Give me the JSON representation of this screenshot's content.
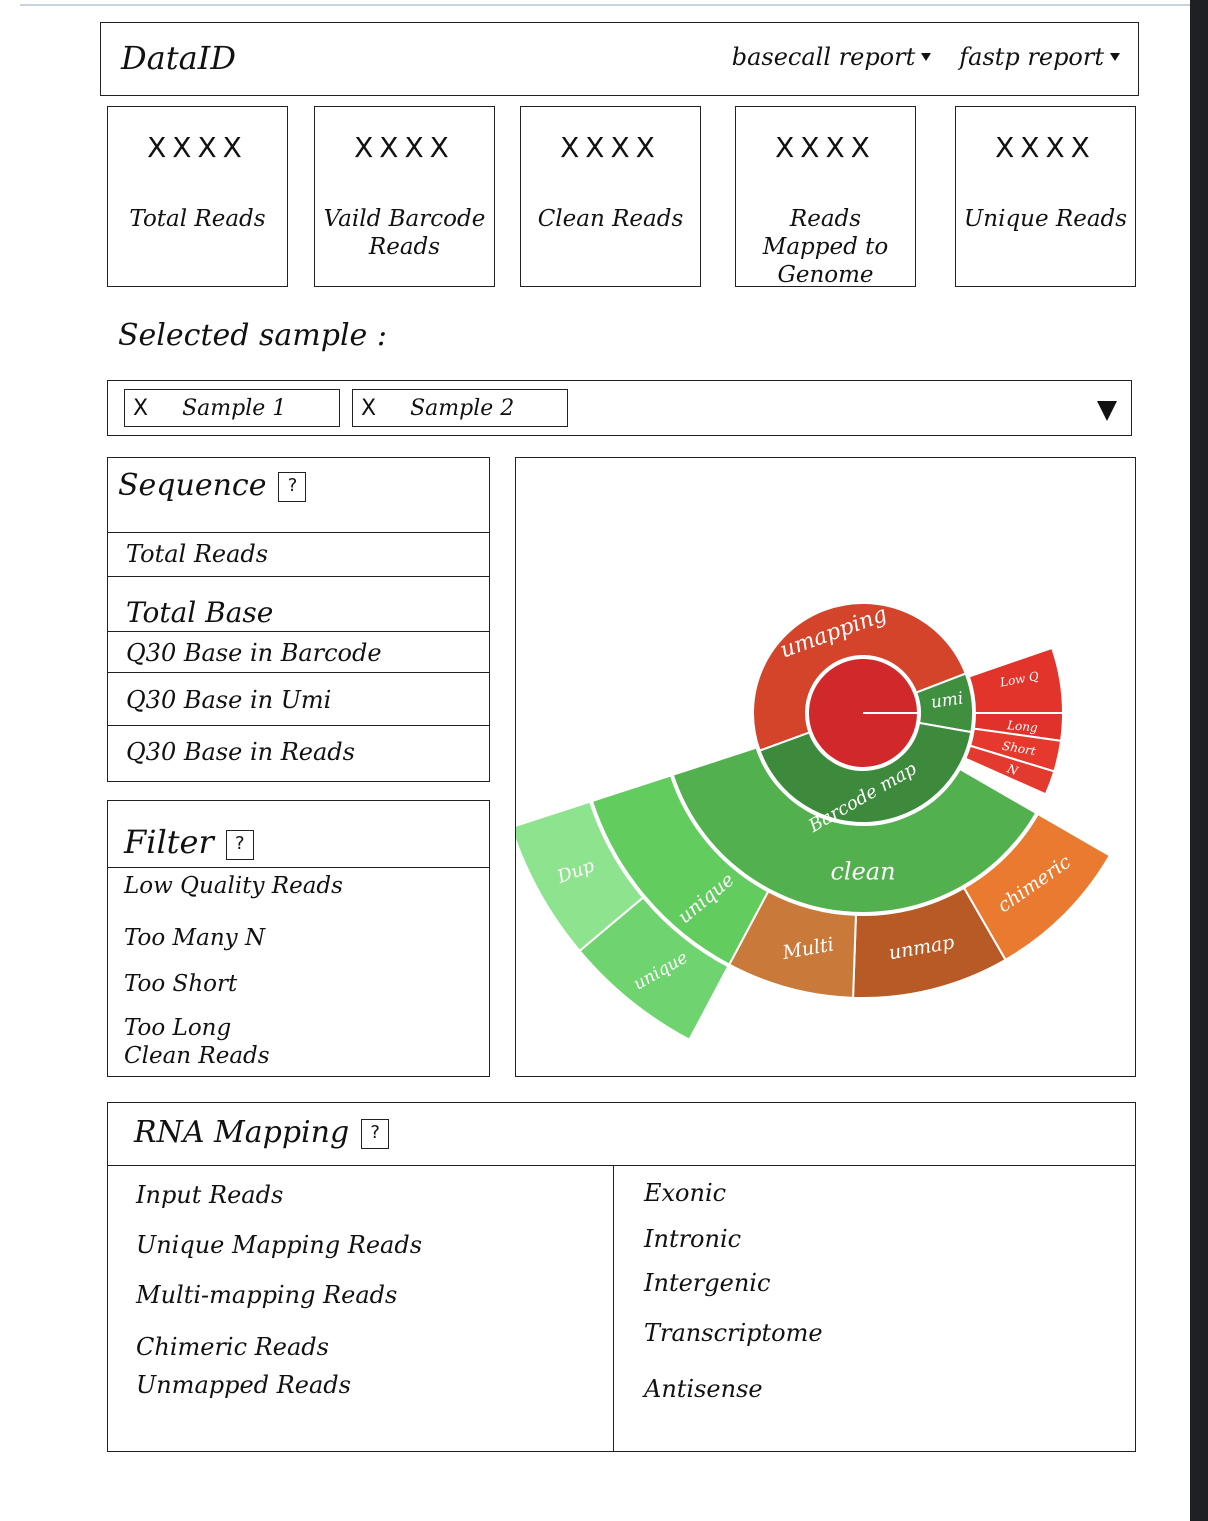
{
  "header": {
    "logo": "DataID",
    "menu_basecall": "basecall report",
    "menu_fastp": "fastp report"
  },
  "stats": [
    {
      "value": "XXXX",
      "label": "Total Reads"
    },
    {
      "value": "XXXX",
      "label": "Vaild Barcode Reads"
    },
    {
      "value": "XXXX",
      "label": "Clean Reads"
    },
    {
      "value": "XXXX",
      "label": "Reads Mapped to Genome"
    },
    {
      "value": "XXXX",
      "label": "Unique Reads"
    }
  ],
  "selected_label": "Selected sample :",
  "chips": [
    {
      "x": "X",
      "label": "Sample 1"
    },
    {
      "x": "X",
      "label": "Sample 2"
    }
  ],
  "sequence": {
    "title": "Sequence",
    "help": "?",
    "rows": [
      "Total Reads",
      "Total Base",
      "Q30 Base in Barcode",
      "Q30 Base in Umi",
      "Q30 Base in Reads"
    ]
  },
  "filter": {
    "title": "Filter",
    "help": "?",
    "items": [
      "Low Quality Reads",
      "Too Many N",
      "Too Short",
      "Too Long",
      "Clean Reads"
    ]
  },
  "rna_mapping": {
    "title": "RNA Mapping",
    "help": "?",
    "left": [
      "Input Reads",
      "Unique Mapping Reads",
      "Multi-mapping Reads",
      "Chimeric Reads",
      "Unmapped Reads"
    ],
    "right": [
      "Exonic",
      "Intronic",
      "Intergenic",
      "Transcriptome",
      "Antisense"
    ]
  },
  "sunburst": {
    "labels": {
      "unmapping": "umapping",
      "umi": "umi",
      "low": "Low Q",
      "long": "Long",
      "short": "Short",
      "n": "N",
      "barcode_map": "Barcode map",
      "clean": "clean",
      "unique": "unique",
      "dup": "Dup",
      "unique2": "unique",
      "multi": "Multi",
      "unmap": "unmap",
      "chimeric": "chimeric"
    },
    "colors": {
      "center": "#d1282b",
      "unmapping": "#d3442a",
      "umi": "#3f8f3f",
      "barcode_map": "#3d8a3d",
      "low_q": "#e3342c",
      "clean": "#52b04f",
      "unique": "#62cc5f",
      "dup": "#8ee38e",
      "unique2": "#6fd46f",
      "multi": "#c97a3a",
      "unmap": "#b85a26",
      "chimeric": "#ea7a30"
    }
  }
}
